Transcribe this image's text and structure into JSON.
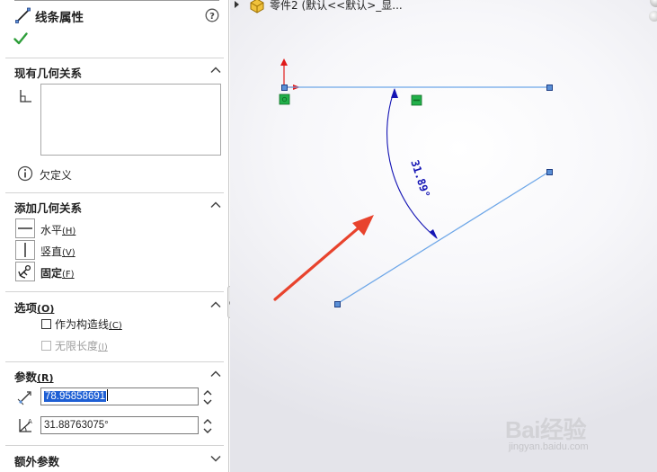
{
  "panel": {
    "title": "线条属性",
    "existing_relations": {
      "title": "现有几何关系",
      "status": "欠定义"
    },
    "add_relations": {
      "title": "添加几何关系",
      "items": [
        {
          "label": "水平",
          "key": "(H)"
        },
        {
          "label": "竖直",
          "key": "(V)"
        },
        {
          "label": "固定",
          "key": "(F)"
        }
      ]
    },
    "options": {
      "title": "选项",
      "title_key": "(O)",
      "construction": {
        "label": "作为构造线",
        "key": "(C)",
        "checked": false
      },
      "infinite": {
        "label": "无限长度",
        "key": "(I)",
        "checked": false,
        "disabled": true
      }
    },
    "parameters": {
      "title": "参数",
      "title_key": "(R)",
      "length_value": "78.95858691",
      "angle_value": "31.88763075°"
    },
    "extra_parameters": {
      "title": "额外参数"
    }
  },
  "viewport": {
    "tree_label": "零件2  (默认<<默认>_显...",
    "dimension_label": "31.89°"
  },
  "colors": {
    "sketch_line": "#6ea7e8",
    "dimension": "#1414b4",
    "arrow": "#e8432d",
    "relation_badge": "#22b04a",
    "accept_check": "#2e9e3a"
  },
  "watermark": {
    "brand": "Bai经验",
    "url": "jingyan.baidu.com"
  }
}
